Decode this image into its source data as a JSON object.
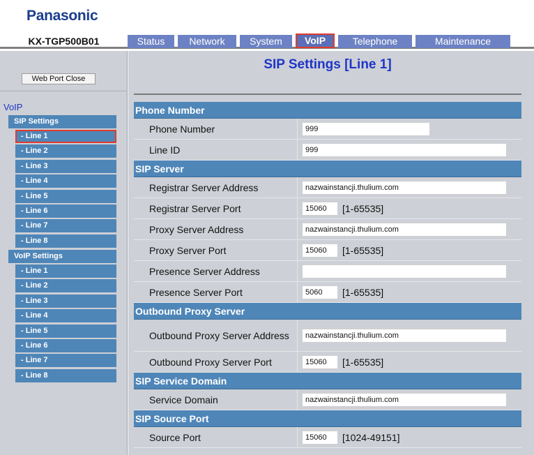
{
  "header": {
    "logo": "Panasonic",
    "model": "KX-TGP500B01",
    "tabs": [
      {
        "label": "Status",
        "width": 67
      },
      {
        "label": "Network",
        "width": 84
      },
      {
        "label": "System",
        "width": 75
      },
      {
        "label": "VoIP",
        "width": 56,
        "active": true
      },
      {
        "label": "Telephone",
        "width": 106
      },
      {
        "label": "Maintenance",
        "width": 136
      }
    ]
  },
  "sidebar": {
    "close_button": "Web Port Close",
    "section_title": "VoIP",
    "sip_group": "SIP Settings",
    "sip_lines": [
      "- Line 1",
      "- Line 2",
      "- Line 3",
      "- Line 4",
      "- Line 5",
      "- Line 6",
      "- Line 7",
      "- Line 8"
    ],
    "voip_group": "VoIP Settings",
    "voip_lines": [
      "- Line 1",
      "- Line 2",
      "- Line 3",
      "- Line 4",
      "- Line 5",
      "- Line 6",
      "- Line 7",
      "- Line 8"
    ]
  },
  "main": {
    "title": "SIP Settings [Line 1]",
    "sections": {
      "phone_number": {
        "title": "Phone Number",
        "phone_number_label": "Phone Number",
        "phone_number_value": "999",
        "line_id_label": "Line ID",
        "line_id_value": "999"
      },
      "sip_server": {
        "title": "SIP Server",
        "registrar_address_label": "Registrar Server Address",
        "registrar_address_value": "nazwainstancji.thulium.com",
        "registrar_port_label": "Registrar Server Port",
        "registrar_port_value": "15060",
        "registrar_port_range": "[1-65535]",
        "proxy_address_label": "Proxy Server Address",
        "proxy_address_value": "nazwainstancji.thulium.com",
        "proxy_port_label": "Proxy Server Port",
        "proxy_port_value": "15060",
        "proxy_port_range": "[1-65535]",
        "presence_address_label": "Presence Server Address",
        "presence_address_value": "",
        "presence_port_label": "Presence Server Port",
        "presence_port_value": "5060",
        "presence_port_range": "[1-65535]"
      },
      "outbound_proxy": {
        "title": "Outbound Proxy Server",
        "address_label": "Outbound Proxy Server Address",
        "address_value": "nazwainstancji.thulium.com",
        "port_label": "Outbound Proxy Server Port",
        "port_value": "15060",
        "port_range": "[1-65535]"
      },
      "service_domain": {
        "title": "SIP Service Domain",
        "label": "Service Domain",
        "value": "nazwainstancji.thulium.com"
      },
      "source_port": {
        "title": "SIP Source Port",
        "label": "Source Port",
        "value": "15060",
        "range": "[1024-49151]"
      }
    }
  }
}
